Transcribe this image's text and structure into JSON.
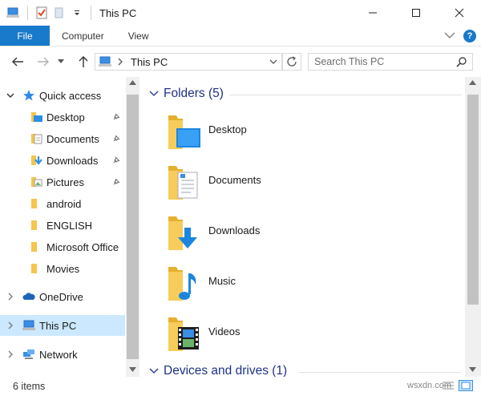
{
  "window": {
    "title": "This PC"
  },
  "ribbon": {
    "tabs": [
      {
        "label": "File"
      },
      {
        "label": "Computer"
      },
      {
        "label": "View"
      }
    ]
  },
  "address": {
    "path": "This PC",
    "search_placeholder": "Search This PC"
  },
  "nav": {
    "items": [
      {
        "label": "Quick access"
      },
      {
        "label": "Desktop"
      },
      {
        "label": "Documents"
      },
      {
        "label": "Downloads"
      },
      {
        "label": "Pictures"
      },
      {
        "label": "android"
      },
      {
        "label": "ENGLISH"
      },
      {
        "label": "Microsoft Office"
      },
      {
        "label": "Movies"
      },
      {
        "label": "OneDrive"
      },
      {
        "label": "This PC"
      },
      {
        "label": "Network"
      }
    ]
  },
  "content": {
    "groups": [
      {
        "title": "Folders (5)"
      },
      {
        "title": "Devices and drives (1)"
      }
    ],
    "folders": [
      {
        "label": "Desktop",
        "icon": "desktop-folder-icon"
      },
      {
        "label": "Documents",
        "icon": "documents-folder-icon"
      },
      {
        "label": "Downloads",
        "icon": "downloads-folder-icon"
      },
      {
        "label": "Music",
        "icon": "music-folder-icon"
      },
      {
        "label": "Videos",
        "icon": "videos-folder-icon"
      }
    ]
  },
  "status": {
    "item_count": "6 items",
    "watermark": "wsxdn.com"
  },
  "colors": {
    "accent": "#1979ca",
    "selection": "#cce8ff",
    "group_header": "#1e3287",
    "folder_yellow": "#f5c54c"
  }
}
